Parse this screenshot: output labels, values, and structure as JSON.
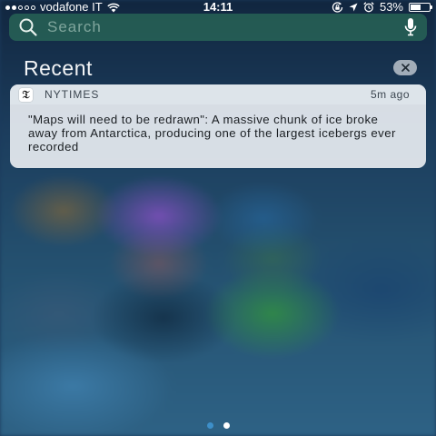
{
  "status_bar": {
    "carrier": "vodafone IT",
    "time": "14:11",
    "battery_percent_label": "53%",
    "battery_level": 0.53,
    "signal_bars_filled": 2,
    "signal_bars_total": 5,
    "icons": [
      "wifi-icon",
      "rotation-lock-icon",
      "location-arrow-icon",
      "alarm-clock-icon",
      "battery-icon"
    ]
  },
  "search": {
    "placeholder": "Search",
    "icons": [
      "search-icon",
      "microphone-icon"
    ]
  },
  "recent": {
    "title": "Recent",
    "clear_icon": "close-icon"
  },
  "notifications": [
    {
      "app": "NYTIMES",
      "app_icon": "nytimes-logo-icon",
      "time": "5m ago",
      "message": "\"Maps will need to be redrawn\": A massive chunk of ice broke away from Antarctica, producing one of the largest icebergs ever recorded"
    }
  ],
  "page_indicator": {
    "pages": 2,
    "current": 2,
    "colors": {
      "active": "#ffffff",
      "inactive": "#3d8fc9"
    }
  },
  "colors": {
    "search_bar": "#2e785c",
    "notification_bg": "#eceff3",
    "text_dark": "#1a1e22"
  }
}
